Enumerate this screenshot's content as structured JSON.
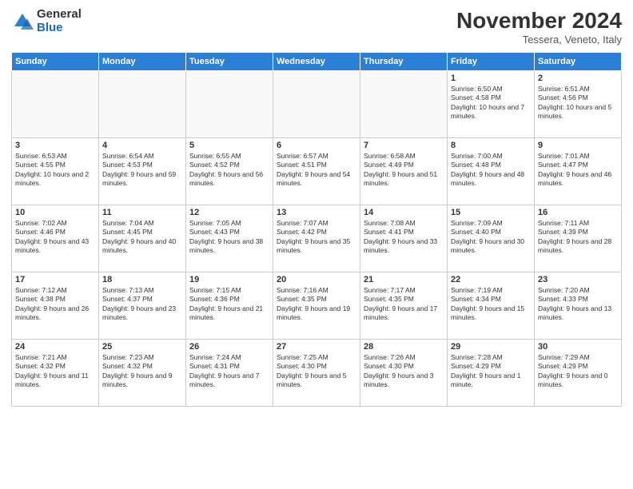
{
  "logo": {
    "general": "General",
    "blue": "Blue"
  },
  "title": "November 2024",
  "subtitle": "Tessera, Veneto, Italy",
  "days_header": [
    "Sunday",
    "Monday",
    "Tuesday",
    "Wednesday",
    "Thursday",
    "Friday",
    "Saturday"
  ],
  "weeks": [
    [
      {
        "day": "",
        "info": ""
      },
      {
        "day": "",
        "info": ""
      },
      {
        "day": "",
        "info": ""
      },
      {
        "day": "",
        "info": ""
      },
      {
        "day": "",
        "info": ""
      },
      {
        "day": "1",
        "info": "Sunrise: 6:50 AM\nSunset: 4:58 PM\nDaylight: 10 hours and 7 minutes."
      },
      {
        "day": "2",
        "info": "Sunrise: 6:51 AM\nSunset: 4:56 PM\nDaylight: 10 hours and 5 minutes."
      }
    ],
    [
      {
        "day": "3",
        "info": "Sunrise: 6:53 AM\nSunset: 4:55 PM\nDaylight: 10 hours and 2 minutes."
      },
      {
        "day": "4",
        "info": "Sunrise: 6:54 AM\nSunset: 4:53 PM\nDaylight: 9 hours and 59 minutes."
      },
      {
        "day": "5",
        "info": "Sunrise: 6:55 AM\nSunset: 4:52 PM\nDaylight: 9 hours and 56 minutes."
      },
      {
        "day": "6",
        "info": "Sunrise: 6:57 AM\nSunset: 4:51 PM\nDaylight: 9 hours and 54 minutes."
      },
      {
        "day": "7",
        "info": "Sunrise: 6:58 AM\nSunset: 4:49 PM\nDaylight: 9 hours and 51 minutes."
      },
      {
        "day": "8",
        "info": "Sunrise: 7:00 AM\nSunset: 4:48 PM\nDaylight: 9 hours and 48 minutes."
      },
      {
        "day": "9",
        "info": "Sunrise: 7:01 AM\nSunset: 4:47 PM\nDaylight: 9 hours and 46 minutes."
      }
    ],
    [
      {
        "day": "10",
        "info": "Sunrise: 7:02 AM\nSunset: 4:46 PM\nDaylight: 9 hours and 43 minutes."
      },
      {
        "day": "11",
        "info": "Sunrise: 7:04 AM\nSunset: 4:45 PM\nDaylight: 9 hours and 40 minutes."
      },
      {
        "day": "12",
        "info": "Sunrise: 7:05 AM\nSunset: 4:43 PM\nDaylight: 9 hours and 38 minutes."
      },
      {
        "day": "13",
        "info": "Sunrise: 7:07 AM\nSunset: 4:42 PM\nDaylight: 9 hours and 35 minutes."
      },
      {
        "day": "14",
        "info": "Sunrise: 7:08 AM\nSunset: 4:41 PM\nDaylight: 9 hours and 33 minutes."
      },
      {
        "day": "15",
        "info": "Sunrise: 7:09 AM\nSunset: 4:40 PM\nDaylight: 9 hours and 30 minutes."
      },
      {
        "day": "16",
        "info": "Sunrise: 7:11 AM\nSunset: 4:39 PM\nDaylight: 9 hours and 28 minutes."
      }
    ],
    [
      {
        "day": "17",
        "info": "Sunrise: 7:12 AM\nSunset: 4:38 PM\nDaylight: 9 hours and 26 minutes."
      },
      {
        "day": "18",
        "info": "Sunrise: 7:13 AM\nSunset: 4:37 PM\nDaylight: 9 hours and 23 minutes."
      },
      {
        "day": "19",
        "info": "Sunrise: 7:15 AM\nSunset: 4:36 PM\nDaylight: 9 hours and 21 minutes."
      },
      {
        "day": "20",
        "info": "Sunrise: 7:16 AM\nSunset: 4:35 PM\nDaylight: 9 hours and 19 minutes."
      },
      {
        "day": "21",
        "info": "Sunrise: 7:17 AM\nSunset: 4:35 PM\nDaylight: 9 hours and 17 minutes."
      },
      {
        "day": "22",
        "info": "Sunrise: 7:19 AM\nSunset: 4:34 PM\nDaylight: 9 hours and 15 minutes."
      },
      {
        "day": "23",
        "info": "Sunrise: 7:20 AM\nSunset: 4:33 PM\nDaylight: 9 hours and 13 minutes."
      }
    ],
    [
      {
        "day": "24",
        "info": "Sunrise: 7:21 AM\nSunset: 4:32 PM\nDaylight: 9 hours and 11 minutes."
      },
      {
        "day": "25",
        "info": "Sunrise: 7:23 AM\nSunset: 4:32 PM\nDaylight: 9 hours and 9 minutes."
      },
      {
        "day": "26",
        "info": "Sunrise: 7:24 AM\nSunset: 4:31 PM\nDaylight: 9 hours and 7 minutes."
      },
      {
        "day": "27",
        "info": "Sunrise: 7:25 AM\nSunset: 4:30 PM\nDaylight: 9 hours and 5 minutes."
      },
      {
        "day": "28",
        "info": "Sunrise: 7:26 AM\nSunset: 4:30 PM\nDaylight: 9 hours and 3 minutes."
      },
      {
        "day": "29",
        "info": "Sunrise: 7:28 AM\nSunset: 4:29 PM\nDaylight: 9 hours and 1 minute."
      },
      {
        "day": "30",
        "info": "Sunrise: 7:29 AM\nSunset: 4:29 PM\nDaylight: 9 hours and 0 minutes."
      }
    ]
  ]
}
